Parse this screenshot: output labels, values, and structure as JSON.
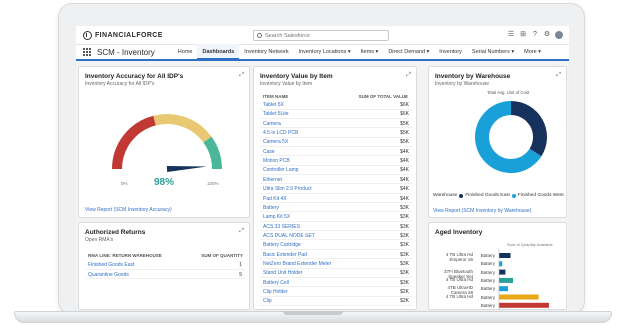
{
  "app": {
    "logo_text": "FINANCIALFORCE",
    "name": "SCM - Inventory",
    "search_placeholder": "Search Salesforce"
  },
  "nav": {
    "items": [
      {
        "label": "Home",
        "active": false
      },
      {
        "label": "Dashboards",
        "active": true
      },
      {
        "label": "Inventory Network",
        "active": false
      },
      {
        "label": "Inventory Locations ▾",
        "active": false
      },
      {
        "label": "Items ▾",
        "active": false
      },
      {
        "label": "Direct Demand ▾",
        "active": false
      },
      {
        "label": "Inventory",
        "active": false
      },
      {
        "label": "Serial Numbers ▾",
        "active": false
      },
      {
        "label": "More ▾",
        "active": false
      }
    ]
  },
  "accuracy": {
    "title": "Inventory Accuracy for All IDP's",
    "subtitle": "Inventory Accuracy for All IDP's",
    "value": "98%",
    "value_fraction": 0.98,
    "tick_min": "0%",
    "tick_max": "100%",
    "link": "View Report (SCM Inventory Accuracy)",
    "colors": {
      "red": "#c23934",
      "yellow": "#e8c873",
      "green": "#4bb79a",
      "needle": "#16325c"
    }
  },
  "value_by_item": {
    "title": "Inventory Value by Item",
    "subtitle": "Inventory Value by Item",
    "col_item": "ITEM NAME",
    "col_value": "SUM OF TOTAL VALUE",
    "rows": [
      {
        "name": "Tablet 5X",
        "value": "$6K"
      },
      {
        "name": "Tablet 5Lite",
        "value": "$6K"
      },
      {
        "name": "Camera",
        "value": "$5K"
      },
      {
        "name": "4.5 in LCD PCB",
        "value": "$5K"
      },
      {
        "name": "Camera 5X",
        "value": "$5K"
      },
      {
        "name": "Case",
        "value": "$4K"
      },
      {
        "name": "Motion PCB",
        "value": "$4K"
      },
      {
        "name": "Controller Lamp",
        "value": "$4K"
      },
      {
        "name": "Ethernet",
        "value": "$4K"
      },
      {
        "name": "Ultra Slim 2.5 Product",
        "value": "$4K"
      },
      {
        "name": "Pad Kit 4X",
        "value": "$4K"
      },
      {
        "name": "Battery",
        "value": "$3K"
      },
      {
        "name": "Lamp Kit 5X",
        "value": "$3K"
      },
      {
        "name": "ACS 33 SERIES",
        "value": "$3K"
      },
      {
        "name": "ACS DUAL NODE SET",
        "value": "$3K"
      },
      {
        "name": "Battery Cartridge",
        "value": "$3K"
      },
      {
        "name": "Basic Extender Pad",
        "value": "$3K"
      },
      {
        "name": "NetZero Brand Extender Meter",
        "value": "$3K"
      },
      {
        "name": "Stand Unit Holder",
        "value": "$3K"
      },
      {
        "name": "Battery Cell",
        "value": "$3K"
      },
      {
        "name": "Clip Holder",
        "value": "$2K"
      },
      {
        "name": "Clip",
        "value": "$2K"
      }
    ]
  },
  "by_warehouse": {
    "title": "Inventory by Warehouse",
    "subtitle": "Inventory by Warehouse",
    "inner_label": "Total Avg. Unit of Cost",
    "legend_title": "Warehouse",
    "legend": [
      {
        "name": "Finished Goods East",
        "color": "#16325c"
      },
      {
        "name": "Finished Goods West",
        "color": "#1aa0d8"
      }
    ],
    "link": "View Report (SCM Inventory by Warehouse)",
    "slices": [
      0.34,
      0.66
    ]
  },
  "returns": {
    "title": "Authorized Returns",
    "subtitle": "Open RMA's",
    "col_name": "RMA LINE: RETURN WAREHOUSE",
    "col_value": "SUM OF QUANTITY",
    "rows": [
      {
        "name": "Finished Goods East",
        "value": "1"
      },
      {
        "name": "Quarantine Goods",
        "value": "5"
      }
    ]
  },
  "aged": {
    "title": "Aged Inventory",
    "legend": "Sum of Quantity Available",
    "axis_max": "12",
    "rows": [
      {
        "label": "4 TB Ultra Hd Emperor 26",
        "group": "Battery",
        "value": 0.18,
        "color": "#16325c"
      },
      {
        "label": "",
        "group": "Battery",
        "value": 0.05,
        "color": "#1aa0d8"
      },
      {
        "label": "37Fi Bluetooth Speaker Set",
        "group": "Battery",
        "value": 0.1,
        "color": "#16325c"
      },
      {
        "label": "4 TB Ultra Hd",
        "group": "Battery",
        "value": 0.22,
        "color": "#2aa198"
      },
      {
        "label": "4TB UltraHD Camera 28",
        "group": "Battery",
        "value": 0.14,
        "color": "#1aa0d8"
      },
      {
        "label": "4 TB Ultra Hd",
        "group": "Battery",
        "value": 0.62,
        "color": "#e6a817"
      },
      {
        "label": "",
        "group": "Battery",
        "value": 0.78,
        "color": "#c23934"
      }
    ]
  }
}
